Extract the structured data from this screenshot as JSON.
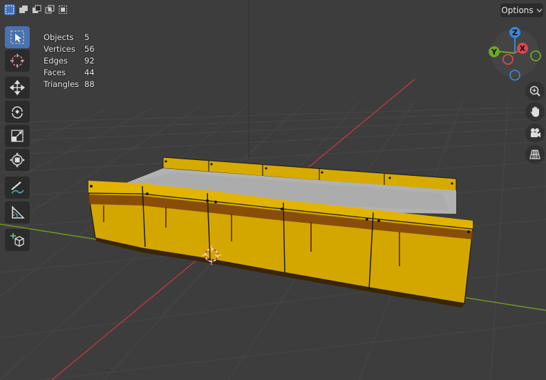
{
  "header": {
    "selection_modes": [
      {
        "name": "select-new-mode-icon",
        "active": true
      },
      {
        "name": "select-extend-mode-icon",
        "active": false
      },
      {
        "name": "select-subtract-mode-icon",
        "active": false
      },
      {
        "name": "select-difference-mode-icon",
        "active": false
      },
      {
        "name": "select-intersect-mode-icon",
        "active": false
      }
    ],
    "options_label": "Options"
  },
  "stats": {
    "rows": [
      {
        "label": "Objects",
        "value": "5"
      },
      {
        "label": "Vertices",
        "value": "56"
      },
      {
        "label": "Edges",
        "value": "92"
      },
      {
        "label": "Faces",
        "value": "44"
      },
      {
        "label": "Triangles",
        "value": "88"
      }
    ]
  },
  "toolbar": {
    "tools": [
      {
        "name": "select-box-tool",
        "icon": "select-box-icon",
        "active": true
      },
      {
        "name": "cursor-tool",
        "icon": "cursor-icon",
        "active": false
      },
      {
        "name": "move-tool",
        "icon": "move-icon",
        "active": false
      },
      {
        "name": "rotate-tool",
        "icon": "rotate-icon",
        "active": false
      },
      {
        "name": "scale-tool",
        "icon": "scale-icon",
        "active": false
      },
      {
        "name": "transform-tool",
        "icon": "transform-icon",
        "active": false
      },
      {
        "name": "annotate-tool",
        "icon": "annotate-icon",
        "active": false
      },
      {
        "name": "measure-tool",
        "icon": "measure-icon",
        "active": false
      },
      {
        "name": "add-cube-tool",
        "icon": "add-cube-icon",
        "active": false
      }
    ]
  },
  "gizmo": {
    "axes": {
      "x": "X",
      "y": "Y",
      "z": "Z"
    },
    "colors": {
      "x": "#e0454f",
      "y": "#6ba829",
      "z": "#3a86d9"
    }
  },
  "navigation": [
    {
      "name": "zoom-button",
      "icon": "zoom-icon"
    },
    {
      "name": "pan-button",
      "icon": "hand-icon"
    },
    {
      "name": "camera-view-button",
      "icon": "camera-icon"
    },
    {
      "name": "perspective-toggle-button",
      "icon": "grid-icon"
    }
  ],
  "colors": {
    "viewport_bg": "#3d3d3d",
    "grid_line": "#474747",
    "x_axis": "#b43a3f",
    "y_axis": "#6e9b1f",
    "object_yellow": "#d7aa00",
    "object_top": "#b4b4b4",
    "active_blue": "#4772b3",
    "panel_bg": "#2b2b2b"
  }
}
